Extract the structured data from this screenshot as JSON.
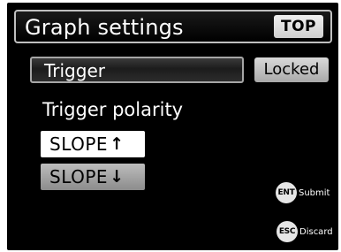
{
  "header": {
    "title": "Graph settings",
    "top_label": "TOP"
  },
  "trigger": {
    "label": "Trigger",
    "status": "Locked"
  },
  "polarity": {
    "heading": "Trigger polarity",
    "options": [
      {
        "label": "SLOPE",
        "arrow": "↑",
        "selected": true
      },
      {
        "label": "SLOPE",
        "arrow": "↓",
        "selected": false
      }
    ]
  },
  "actions": {
    "submit": {
      "key": "ENT",
      "label": "Submit"
    },
    "discard": {
      "key": "ESC",
      "label": "Discard"
    }
  }
}
